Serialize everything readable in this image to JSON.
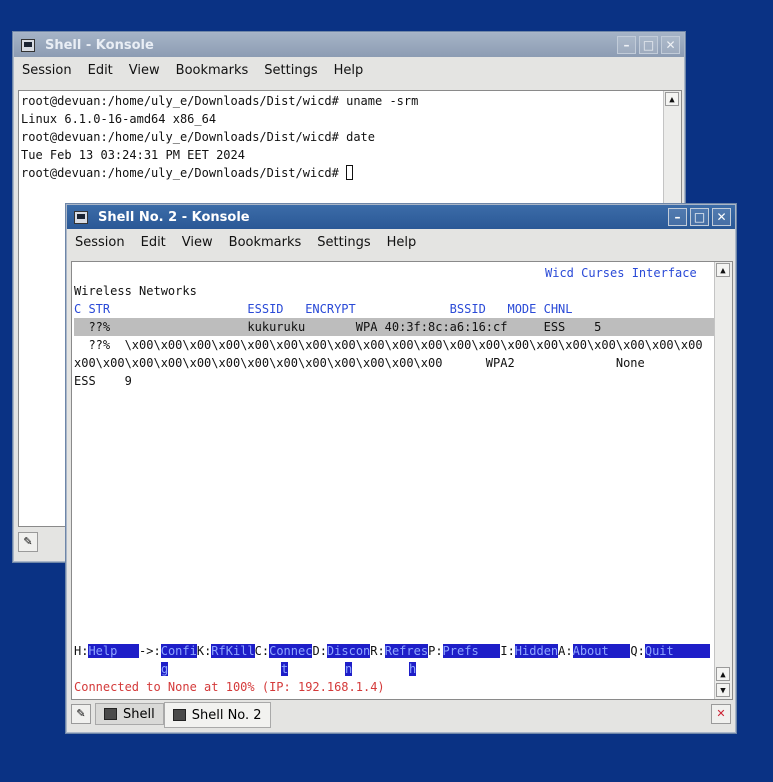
{
  "window1": {
    "title": "Shell - Konsole",
    "menu": [
      "Session",
      "Edit",
      "View",
      "Bookmarks",
      "Settings",
      "Help"
    ],
    "lines": [
      "root@devuan:/home/uly_e/Downloads/Dist/wicd# uname -srm",
      "Linux 6.1.0-16-amd64 x86_64",
      "root@devuan:/home/uly_e/Downloads/Dist/wicd# date",
      "Tue Feb 13 03:24:31 PM EET 2024",
      "root@devuan:/home/uly_e/Downloads/Dist/wicd# "
    ]
  },
  "window2": {
    "title": "Shell No. 2 - Konsole",
    "menu": [
      "Session",
      "Edit",
      "View",
      "Bookmarks",
      "Settings",
      "Help"
    ],
    "app_title": "Wicd Curses Interface",
    "heading": "Wireless Networks",
    "columns": "C STR                   ESSID   ENCRYPT             BSSID   MODE CHNL",
    "rows": [
      "  ??%                   kukuruku       WPA 40:3f:8c:a6:16:cf     ESS    5",
      "  ??%  \\x00\\x00\\x00\\x00\\x00\\x00\\x00\\x00\\x00\\x00\\x00\\x00\\x00\\x00\\x00\\x00\\x00\\x00\\x00\\x00",
      "x00\\x00\\x00\\x00\\x00\\x00\\x00\\x00\\x00\\x00\\x00\\x00\\x00      WPA2              None",
      "ESS    9"
    ],
    "keys": [
      {
        "k": "H:",
        "l": "Help   "
      },
      {
        "k": "->:",
        "l": "Confi"
      },
      {
        "k": "K:",
        "l": "RfKill"
      },
      {
        "k": "C:",
        "l": "Connec"
      },
      {
        "k": "D:",
        "l": "Discon"
      },
      {
        "k": "R:",
        "l": "Refres"
      },
      {
        "k": "P:",
        "l": "Prefs   "
      },
      {
        "k": "I:",
        "l": "Hidden"
      },
      {
        "k": "A:",
        "l": "About   "
      },
      {
        "k": "Q:",
        "l": "Quit     "
      }
    ],
    "keys_wrap": [
      "g",
      "t",
      "n",
      "h"
    ],
    "status": "Connected to None at 100% (IP: 192.168.1.4)",
    "tabs": [
      "Shell",
      "Shell No. 2"
    ]
  },
  "colors": {
    "desktop": "#0a3284",
    "active_title": "#2a5896",
    "key_bg": "#1e1ec8",
    "status": "#d43a3a"
  }
}
